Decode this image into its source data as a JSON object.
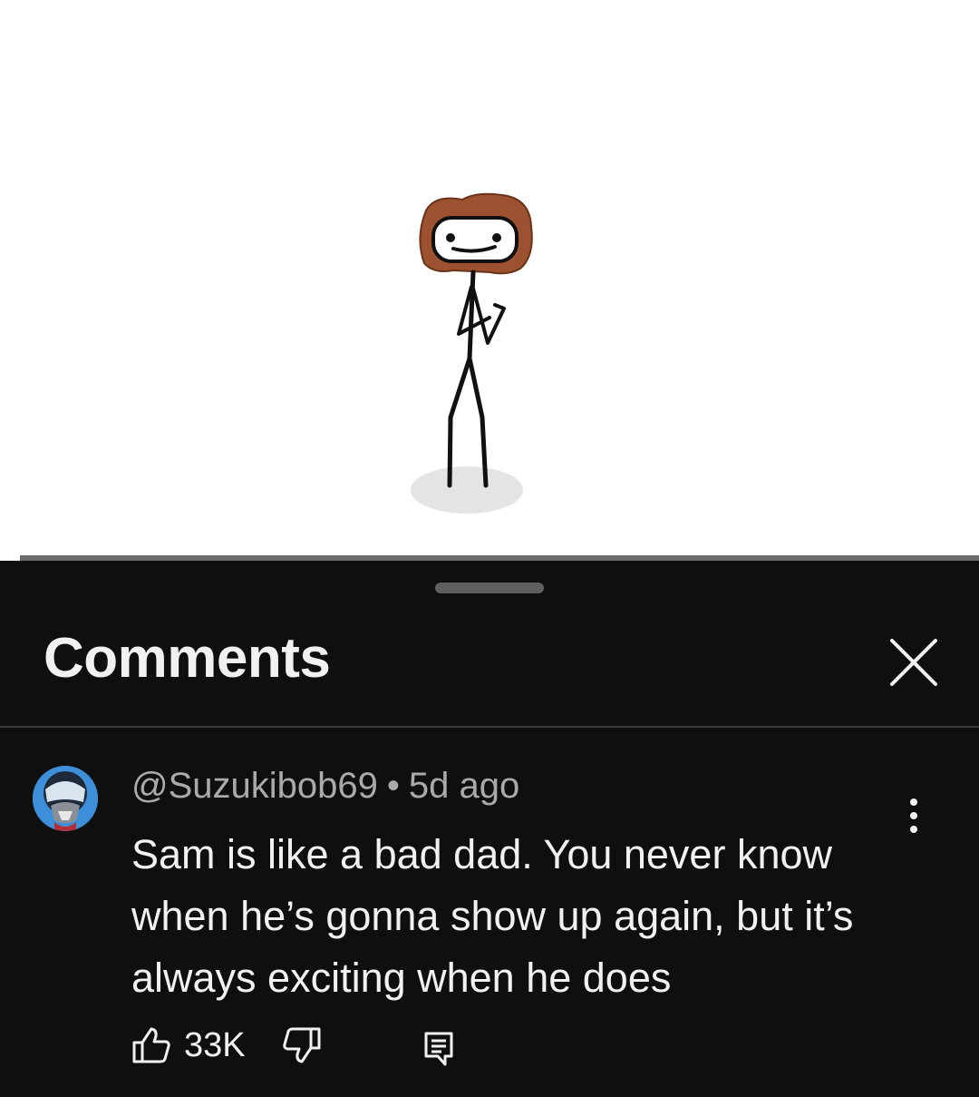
{
  "comments_panel": {
    "title": "Comments",
    "close_icon": "close-icon"
  },
  "comment": {
    "author": "@Suzukibob69",
    "separator": "•",
    "time_ago": "5d ago",
    "text": "Sam is like a bad dad. You never know when he’s gonna show up again, but it’s always exciting when he does",
    "like_count": "33K",
    "icons": {
      "more": "more-vert-icon",
      "like": "thumbs-up-icon",
      "dislike": "thumbs-down-icon",
      "reply": "reply-icon"
    }
  },
  "video": {
    "progress_fraction": 0.02
  },
  "colors": {
    "sheet_background": "#0f0f0f",
    "video_background": "#ffffff",
    "hair": "#9c5230",
    "text_primary": "#f1f1f1",
    "text_secondary": "#aaaaaa"
  }
}
